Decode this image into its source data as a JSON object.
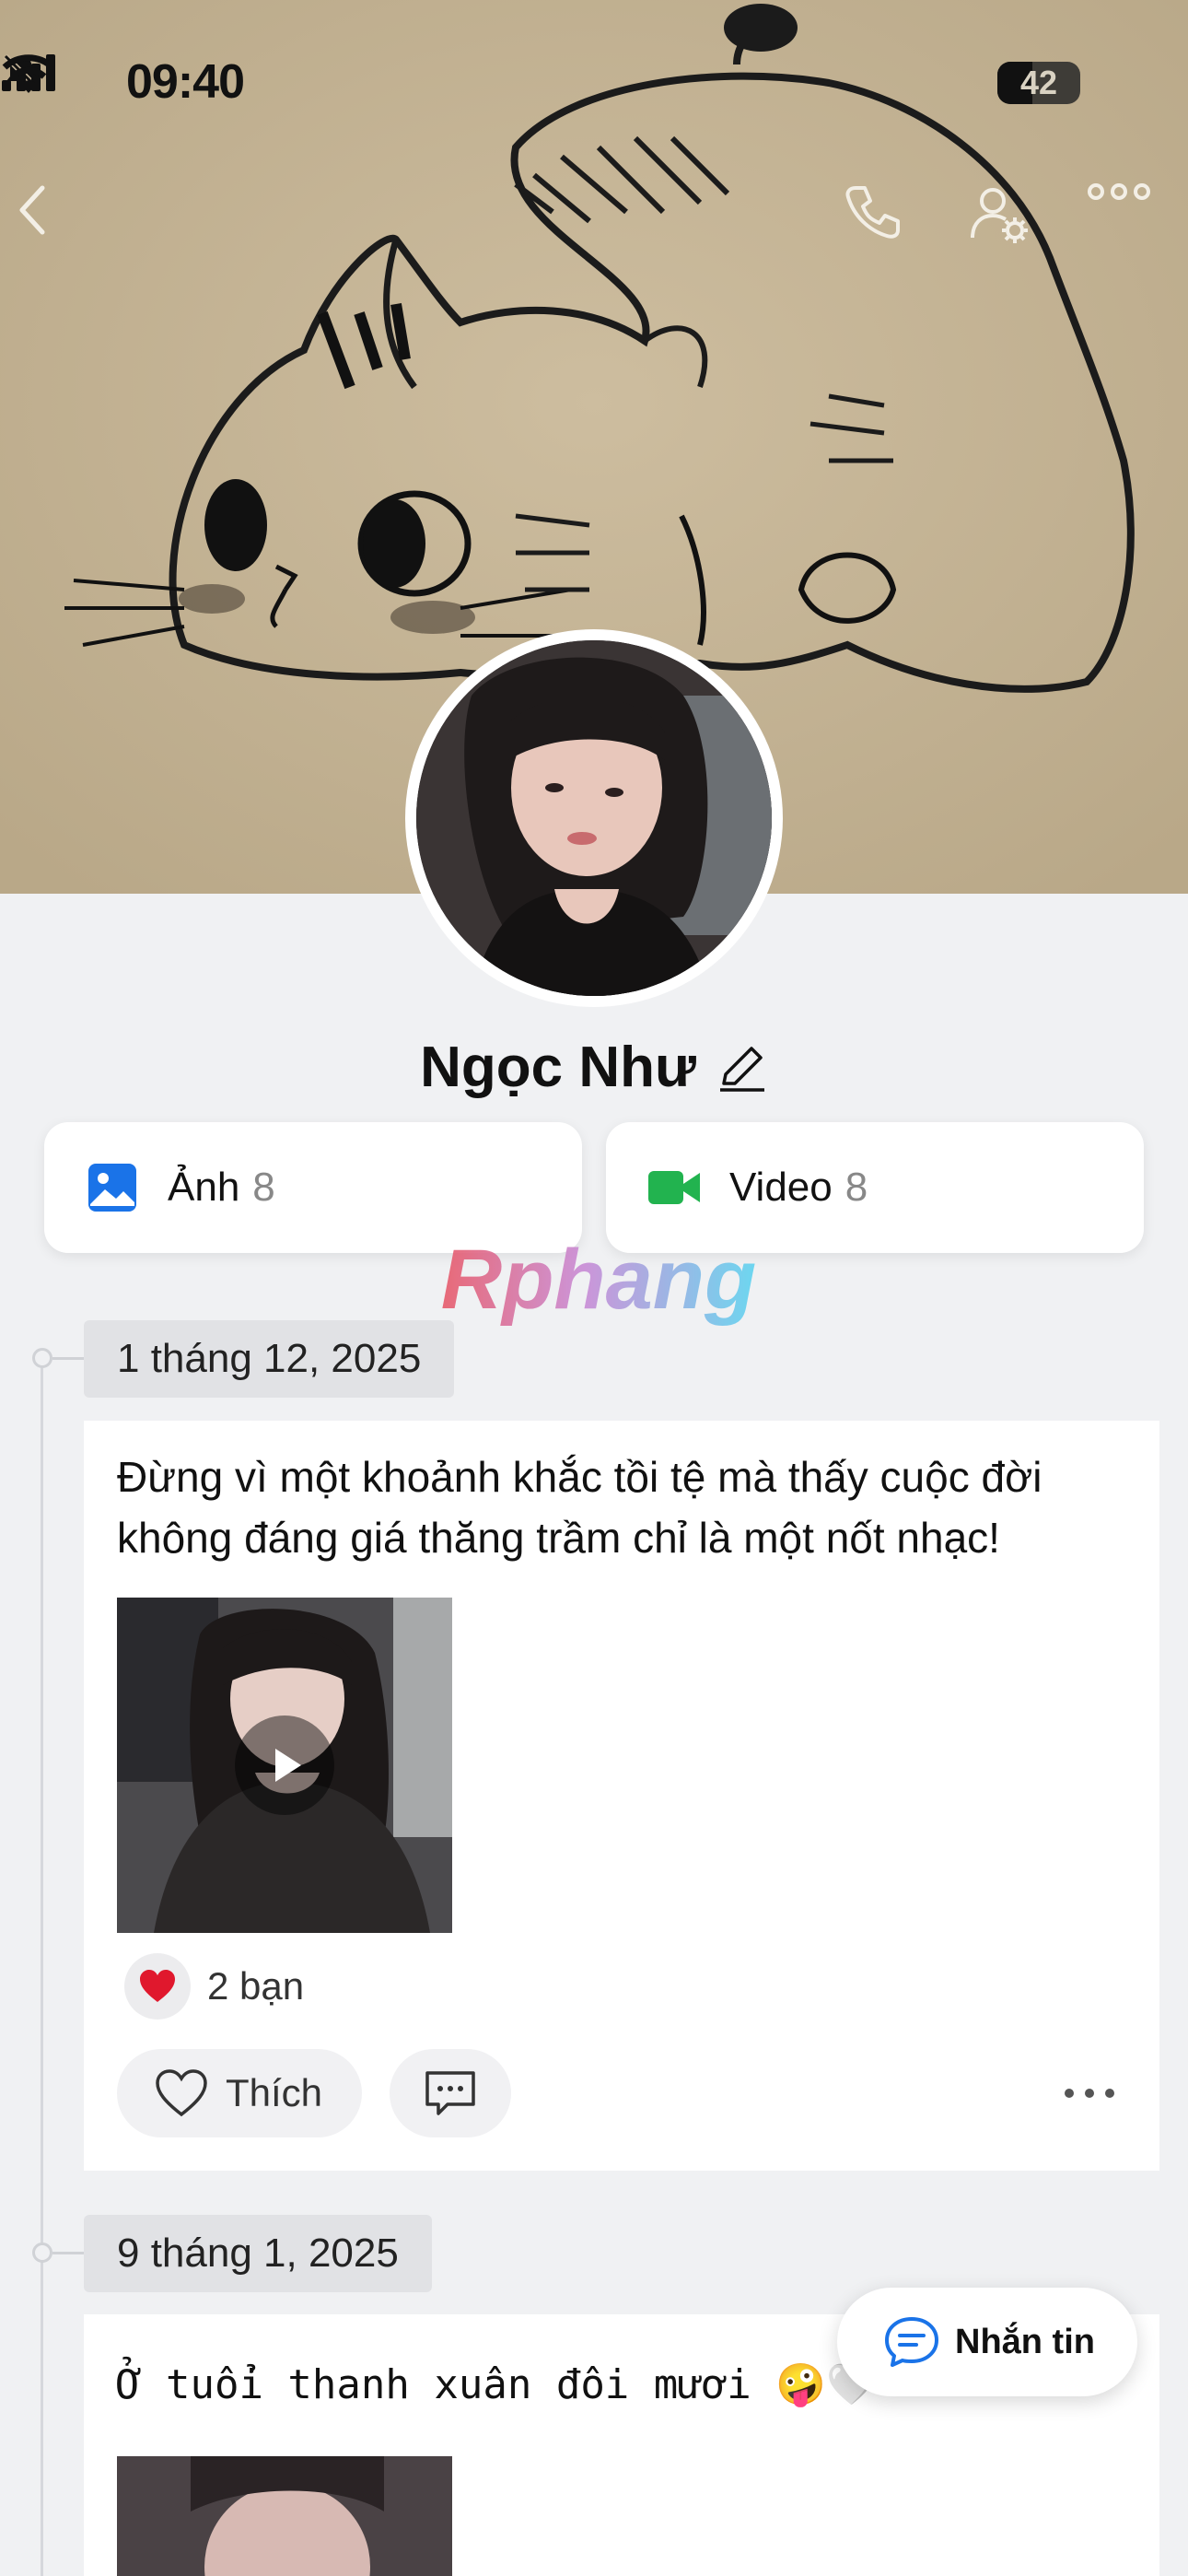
{
  "status_bar": {
    "time": "09:40",
    "battery": "42",
    "battery_level": 0.42
  },
  "nav": {
    "back_icon": "chevron-left-icon",
    "call_icon": "phone-icon",
    "settings_icon": "user-settings-icon",
    "more_icon": "more-horizontal-icon"
  },
  "profile": {
    "name": "Ngọc Như"
  },
  "media": [
    {
      "label": "Ảnh",
      "count": "8",
      "icon": "image-icon",
      "color": "#1a73e8"
    },
    {
      "label": "Video",
      "count": "8",
      "icon": "video-camera-icon",
      "color": "#22b34f"
    }
  ],
  "watermark": "Rphang",
  "posts": [
    {
      "date": "1 tháng 12, 2025",
      "text": "Đừng vì một khoảnh khắc tồi tệ mà thấy cuộc đời không đáng giá thăng trầm chỉ là một nốt nhạc!",
      "reaction_count": "2 bạn",
      "like_label": "Thích"
    },
    {
      "date": "9 tháng 1, 2025",
      "text": "Ở tuổi thanh xuân đôi mươi 🤪🤍"
    }
  ],
  "chat_button": {
    "label": "Nhắn tin"
  },
  "colors": {
    "accent": "#1a73e8",
    "heart": "#e0182d",
    "background": "#f0f1f3"
  }
}
